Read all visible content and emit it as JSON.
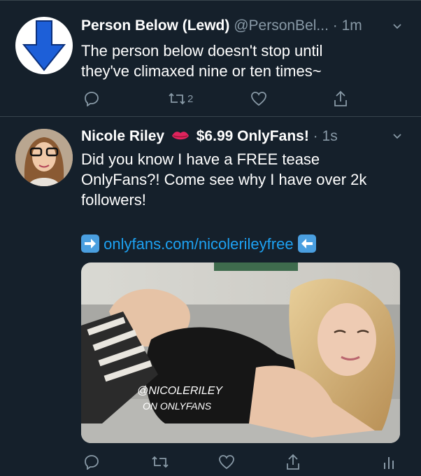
{
  "tweets": [
    {
      "name": "Person Below (Lewd)",
      "handle": "@PersonBel...",
      "dot": "·",
      "time": "1m",
      "avatar_icon": "down-arrow-icon",
      "text_lines": [
        "The person below doesn't stop until",
        "they've climaxed nine or ten times~"
      ],
      "actions": {
        "reply": "",
        "retweet_count": "2",
        "like": "",
        "share": ""
      }
    },
    {
      "name": "Nicole Riley",
      "name_emoji": "kiss-lips-icon",
      "name_suffix": "$6.99 OnlyFans!",
      "dot": "·",
      "time": "1s",
      "text_lines": [
        "Did you know I have a FREE tease",
        "OnlyFans?! Come see why I have over 2k",
        "followers!"
      ],
      "link_text": "onlyfans.com/nicolerileyfree",
      "link_left_icon": "right-arrow-emoji-icon",
      "link_right_icon": "left-arrow-emoji-icon",
      "media_watermark": [
        "@NICOLERILEY",
        "ON ONLYFANS"
      ],
      "actions": {
        "reply": "",
        "retweet_count": "",
        "like": "",
        "share": "",
        "analytics": ""
      }
    }
  ],
  "colors": {
    "background": "#15202b",
    "divider": "#38444d",
    "secondary_text": "#8899a6",
    "link": "#1da1f2",
    "avatar_arrow": "#1d5fd8"
  }
}
